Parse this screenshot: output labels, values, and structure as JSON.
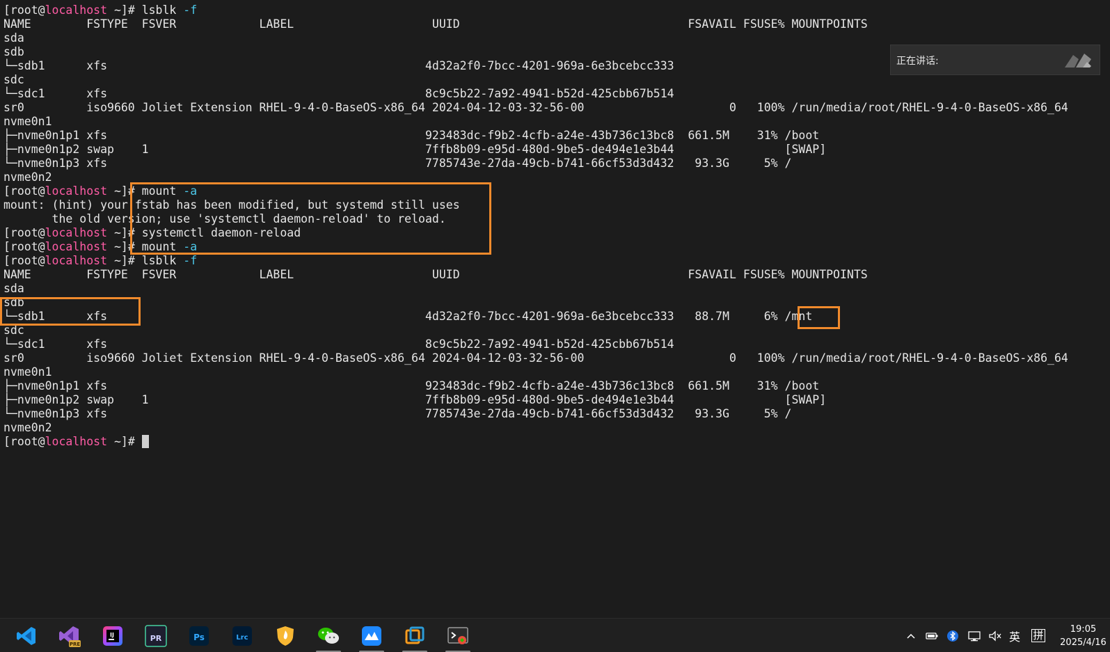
{
  "terminal": {
    "prompt_open": "[root@",
    "host": "localhost",
    "prompt_close": " ~]# ",
    "cmd_lsblk": "lsblk",
    "flag_f": "-f",
    "cmd_mount": "mount",
    "flag_a": "-a",
    "cmd_reload": "systemctl daemon-reload",
    "header": "NAME        FSTYPE  FSVER            LABEL                    UUID                                 FSAVAIL FSUSE% MOUNTPOINTS",
    "before": [
      "sda",
      "sdb",
      "└─sdb1      xfs                                              4d32a2f0-7bcc-4201-969a-6e3bcebcc333",
      "sdc",
      "└─sdc1      xfs                                              8c9c5b22-7a92-4941-b52d-425cbb67b514",
      "sr0         iso9660 Joliet Extension RHEL-9-4-0-BaseOS-x86_64 2024-04-12-03-32-56-00                     0   100% /run/media/root/RHEL-9-4-0-BaseOS-x86_64",
      "nvme0n1",
      "├─nvme0n1p1 xfs                                              923483dc-f9b2-4cfb-a24e-43b736c13bc8  661.5M    31% /boot",
      "├─nvme0n1p2 swap    1                                        7ffb8b09-e95d-480d-9be5-de494e1e3b44                [SWAP]",
      "└─nvme0n1p3 xfs                                              7785743e-27da-49cb-b741-66cf53d3d432   93.3G     5% /",
      "nvme0n2"
    ],
    "mount_hint_1": "mount: (hint) your fstab has been modified, but systemd still uses",
    "mount_hint_2": "       the old version; use 'systemctl daemon-reload' to reload.",
    "after": [
      "sda",
      "sdb",
      "└─sdb1      xfs                                              4d32a2f0-7bcc-4201-969a-6e3bcebcc333   88.7M     6% /mnt",
      "sdc",
      "└─sdc1      xfs                                              8c9c5b22-7a92-4941-b52d-425cbb67b514",
      "sr0         iso9660 Joliet Extension RHEL-9-4-0-BaseOS-x86_64 2024-04-12-03-32-56-00                     0   100% /run/media/root/RHEL-9-4-0-BaseOS-x86_64",
      "nvme0n1",
      "├─nvme0n1p1 xfs                                              923483dc-f9b2-4cfb-a24e-43b736c13bc8  661.5M    31% /boot",
      "├─nvme0n1p2 swap    1                                        7ffb8b09-e95d-480d-9be5-de494e1e3b44                [SWAP]",
      "└─nvme0n1p3 xfs                                              7785743e-27da-49cb-b741-66cf53d3d432   93.3G     5% /",
      "nvme0n2"
    ]
  },
  "speaking_panel": {
    "label": "正在讲话:"
  },
  "taskbar": {
    "apps": [
      {
        "name": "vscode-icon",
        "badge": ""
      },
      {
        "name": "visual-studio-icon",
        "badge": "PRE"
      },
      {
        "name": "jetbrains-icon",
        "badge": ""
      },
      {
        "name": "premiere-icon",
        "badge": "PR"
      },
      {
        "name": "photoshop-icon",
        "badge": "Ps"
      },
      {
        "name": "lightroom-icon",
        "badge": "Lrc"
      },
      {
        "name": "shield-app-icon",
        "badge": ""
      },
      {
        "name": "wechat-icon",
        "badge": ""
      },
      {
        "name": "feishu-icon",
        "badge": ""
      },
      {
        "name": "vmware-icon",
        "badge": ""
      },
      {
        "name": "terminal-app-icon",
        "badge": ""
      }
    ],
    "tray": {
      "ime_lang": "英",
      "ime_mode": "拼"
    },
    "clock": {
      "time": "19:05",
      "date": "2025/4/16"
    },
    "colors": {
      "accent_orange": "#f08a2c",
      "user_pink": "#ff5ca5",
      "option_cyan": "#4cc7e8"
    }
  }
}
